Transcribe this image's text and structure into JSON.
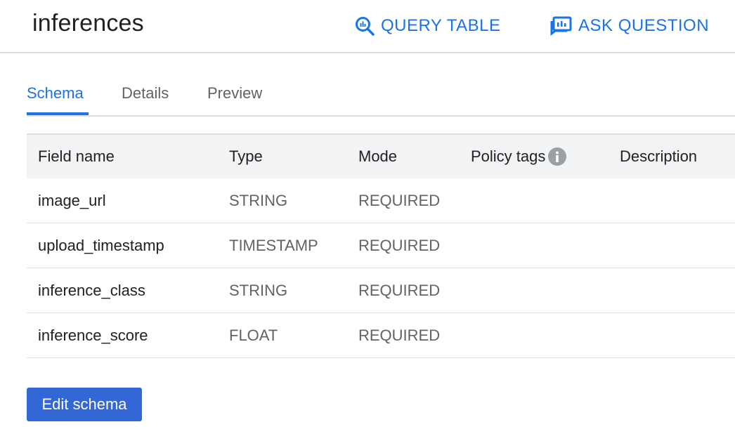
{
  "header": {
    "title": "inferences",
    "query_table_label": "QUERY TABLE",
    "ask_question_label": "ASK QUESTION",
    "query_icon": "query-search-icon",
    "ask_icon": "question-answer-icon"
  },
  "tabs": [
    {
      "label": "Schema",
      "active": true
    },
    {
      "label": "Details",
      "active": false
    },
    {
      "label": "Preview",
      "active": false
    }
  ],
  "table": {
    "columns": [
      "Field name",
      "Type",
      "Mode",
      "Policy tags",
      "Description"
    ],
    "rows": [
      {
        "name": "image_url",
        "type": "STRING",
        "mode": "REQUIRED",
        "policy_tags": "",
        "description": ""
      },
      {
        "name": "upload_timestamp",
        "type": "TIMESTAMP",
        "mode": "REQUIRED",
        "policy_tags": "",
        "description": ""
      },
      {
        "name": "inference_class",
        "type": "STRING",
        "mode": "REQUIRED",
        "policy_tags": "",
        "description": ""
      },
      {
        "name": "inference_score",
        "type": "FLOAT",
        "mode": "REQUIRED",
        "policy_tags": "",
        "description": ""
      }
    ]
  },
  "actions": {
    "edit_schema_label": "Edit schema"
  },
  "colors": {
    "accent": "#1a73e8",
    "button_bg": "#3367d6",
    "header_bg": "#f1f3f4",
    "info_icon": "#9aa0a6"
  }
}
